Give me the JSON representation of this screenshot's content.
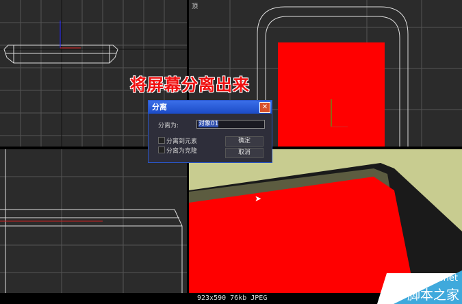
{
  "headline": "将屏幕分离出来",
  "viewports": {
    "top_label": "顶"
  },
  "dialog": {
    "title": "分离",
    "name_label": "分离为:",
    "name_value": "对象01",
    "option1": "分离到元素",
    "option2": "分离为克隆",
    "ok": "确定",
    "cancel": "取消"
  },
  "caption": "923x590 76kb JPEG",
  "watermark": {
    "url": "jb51.net",
    "name": "脚本之家"
  },
  "colors": {
    "screen": "#ff0000",
    "viewport": "#2b2b2b",
    "accent": "#2a56c8"
  }
}
